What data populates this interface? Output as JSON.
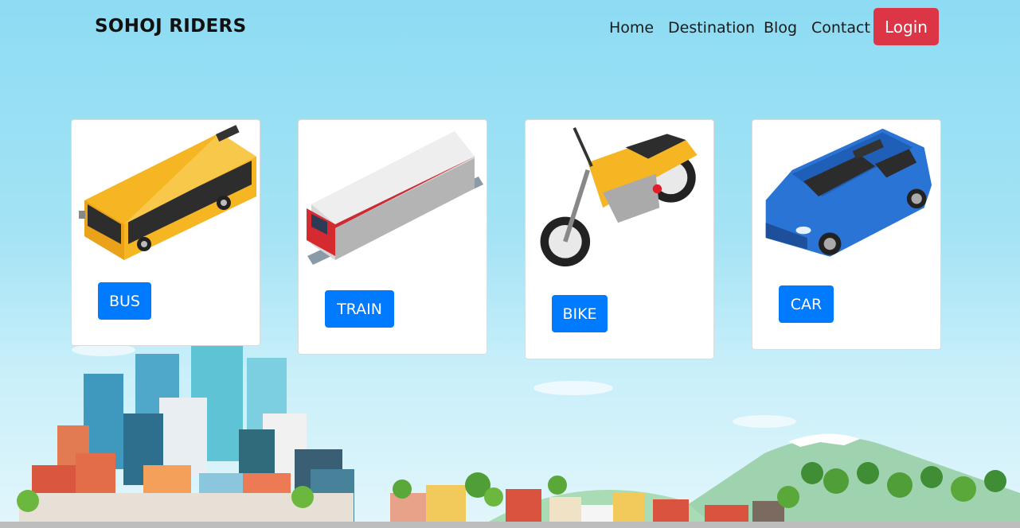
{
  "brand": "SOHOJ RIDERS",
  "nav": {
    "home": "Home",
    "destination": "Destination",
    "blog": "Blog",
    "contact": "Contact",
    "login": "Login"
  },
  "vehicles": [
    {
      "label": "BUS"
    },
    {
      "label": "TRAIN"
    },
    {
      "label": "BIKE"
    },
    {
      "label": "CAR"
    }
  ],
  "colors": {
    "login": "#dc3545",
    "button": "#007bff",
    "sky": "#8ddcf3"
  }
}
